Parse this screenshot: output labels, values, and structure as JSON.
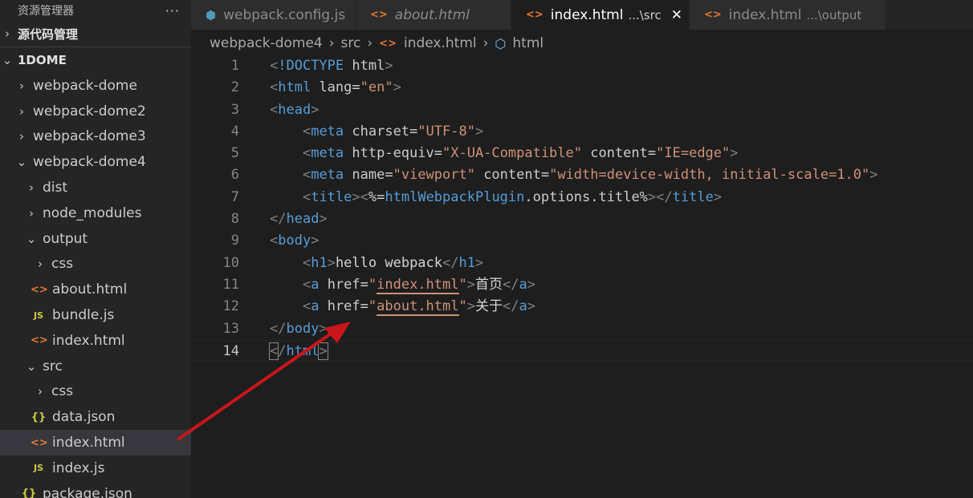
{
  "sidebar": {
    "title": "资源管理器",
    "more_glyph": "···",
    "section_scm": "源代码管理",
    "section_project": "1DOME",
    "tree": [
      {
        "label": "webpack-dome",
        "chev": "›"
      },
      {
        "label": "webpack-dome2",
        "chev": "›"
      },
      {
        "label": "webpack-dome3",
        "chev": "›"
      },
      {
        "label": "webpack-dome4",
        "chev": "⌄"
      },
      {
        "label": "dist",
        "chev": "›"
      },
      {
        "label": "node_modules",
        "chev": "›"
      },
      {
        "label": "output",
        "chev": "⌄"
      },
      {
        "label": "css",
        "chev": "›"
      },
      {
        "label": "about.html",
        "icon": "<>"
      },
      {
        "label": "bundle.js",
        "icon": "JS"
      },
      {
        "label": "index.html",
        "icon": "<>"
      },
      {
        "label": "src",
        "chev": "⌄"
      },
      {
        "label": "css",
        "chev": "›"
      },
      {
        "label": "data.json",
        "icon": "{}"
      },
      {
        "label": "index.html",
        "icon": "<>"
      },
      {
        "label": "index.js",
        "icon": "JS"
      },
      {
        "label": "package.json",
        "icon": "{}"
      }
    ]
  },
  "tabs": [
    {
      "label": "webpack.config.js",
      "icon": "webpack-config-icon"
    },
    {
      "label": "about.html",
      "icon": "html-file-icon"
    },
    {
      "label": "index.html",
      "desc": "...\\src",
      "icon": "html-file-icon"
    },
    {
      "label": "index.html",
      "desc": "...\\output",
      "icon": "html-file-icon"
    }
  ],
  "breadcrumb": {
    "folder": "webpack-dome4",
    "subfolder": "src",
    "file": "index.html",
    "symbol": "html"
  },
  "editor": {
    "line_numbers": [
      "1",
      "2",
      "3",
      "4",
      "5",
      "6",
      "7",
      "8",
      "9",
      "10",
      "11",
      "12",
      "13",
      "14"
    ],
    "current_line": 14,
    "lines": [
      "<!DOCTYPE html>",
      "<html lang=\"en\">",
      "<head>",
      "    <meta charset=\"UTF-8\">",
      "    <meta http-equiv=\"X-UA-Compatible\" content=\"IE=edge\">",
      "    <meta name=\"viewport\" content=\"width=device-width, initial-scale=1.0\">",
      "    <title><%=htmlWebpackPlugin.options.title%></title>",
      "</head>",
      "<body>",
      "    <h1>hello webpack</h1>",
      "    <a href=\"index.html\">首页</a>",
      "    <a href=\"about.html\">关于</a>",
      "</body>",
      "</html>"
    ]
  },
  "colors": {
    "annotation_arrow": "#c8161b",
    "html_icon": "#e37933",
    "js_icon": "#cbcb41",
    "keyword_blue": "#569cd6",
    "attribute": "#9cdcfe",
    "string": "#ce9178"
  }
}
